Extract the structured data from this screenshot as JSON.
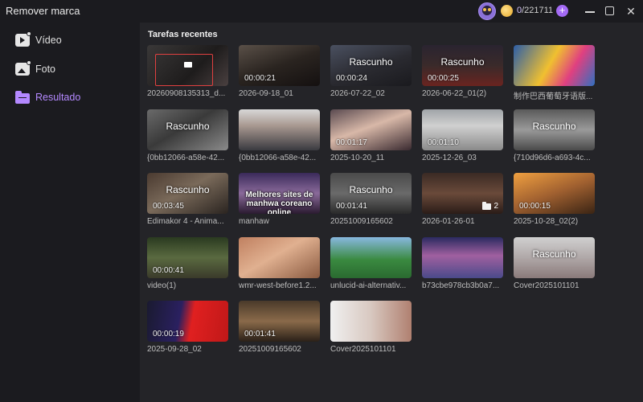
{
  "app": {
    "title": "Remover marca"
  },
  "account": {
    "used": "0",
    "total": "/221711",
    "plus": "+"
  },
  "window_controls": {
    "close": "✕"
  },
  "sidebar": {
    "items": [
      {
        "label": "Vídeo",
        "icon": "video-icon",
        "active": false
      },
      {
        "label": "Foto",
        "icon": "photo-icon",
        "active": false
      },
      {
        "label": "Resultado",
        "icon": "folder-icon",
        "active": true
      }
    ]
  },
  "main": {
    "section_title": "Tarefas recentes",
    "draft_label": "Rascunho",
    "cards": [
      {
        "caption": "20260908135313_d...",
        "duration": "",
        "draft": false
      },
      {
        "caption": "2026-09-18_01",
        "duration": "00:00:21",
        "draft": false
      },
      {
        "caption": "2026-07-22_02",
        "duration": "00:00:24",
        "draft": true
      },
      {
        "caption": "2026-06-22_01(2)",
        "duration": "00:00:25",
        "draft": true
      },
      {
        "caption": "制作巴西葡萄牙语版...",
        "duration": "",
        "draft": false
      },
      {
        "caption": "{0bb12066-a58e-42...",
        "duration": "",
        "draft": true
      },
      {
        "caption": "{0bb12066-a58e-42...",
        "duration": "",
        "draft": false
      },
      {
        "caption": "2025-10-20_11",
        "duration": "00:01:17",
        "draft": false
      },
      {
        "caption": "2025-12-26_03",
        "duration": "00:01:10",
        "draft": false
      },
      {
        "caption": "{710d96d6-a693-4c...",
        "duration": "",
        "draft": true
      },
      {
        "caption": "Edimakor 4 - Anima...",
        "duration": "00:03:45",
        "draft": true
      },
      {
        "caption": "manhaw",
        "duration": "",
        "draft": false,
        "overlay": "Melhores sites de manhwa coreano online"
      },
      {
        "caption": "20251009165602",
        "duration": "00:01:41",
        "draft": true
      },
      {
        "caption": "2026-01-26-01",
        "duration": "",
        "draft": false,
        "folder_count": "2"
      },
      {
        "caption": "2025-10-28_02(2)",
        "duration": "00:00:15",
        "draft": false
      },
      {
        "caption": "video(1)",
        "duration": "00:00:41",
        "draft": false
      },
      {
        "caption": "wmr-west-before1.2...",
        "duration": "",
        "draft": false
      },
      {
        "caption": "unlucid-ai-alternativ...",
        "duration": "",
        "draft": false
      },
      {
        "caption": "b73cbe978cb3b0a7...",
        "duration": "",
        "draft": false
      },
      {
        "caption": "Cover2025101101",
        "duration": "",
        "draft": true
      },
      {
        "caption": "2025-09-28_02",
        "duration": "00:00:19",
        "draft": false
      },
      {
        "caption": "20251009165602",
        "duration": "00:01:41",
        "draft": false
      },
      {
        "caption": "Cover2025101101",
        "duration": "",
        "draft": false
      }
    ]
  },
  "colors": {
    "accent": "#b489ff",
    "plus_button": "#a46bf5",
    "main_bg": "#242428",
    "sidebar_bg": "#1b1b1f"
  }
}
